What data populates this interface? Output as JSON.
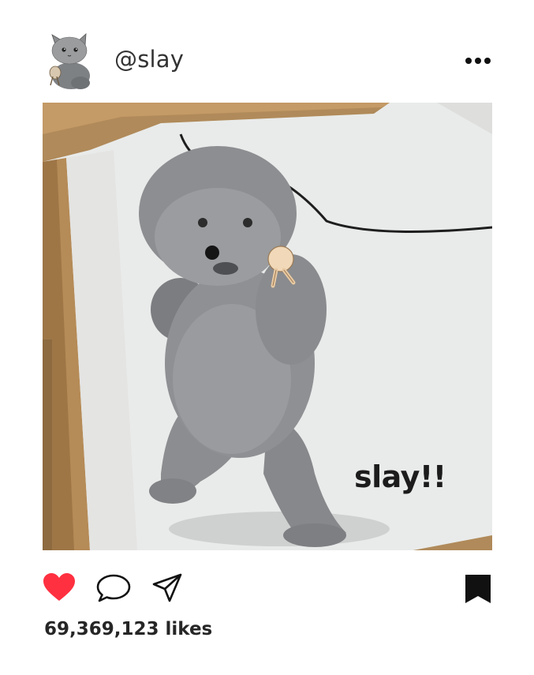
{
  "post": {
    "username": "@slay",
    "image_caption": "slay!!",
    "likes_text": "69,369,123 likes"
  },
  "icons": {
    "avatar": "cat-avatar-icon",
    "more": "more-dots-icon",
    "like": "heart-icon",
    "comment": "speech-bubble-icon",
    "share": "paper-plane-icon",
    "save": "bookmark-icon"
  },
  "colors": {
    "like_active": "#ff3040",
    "text": "#262626",
    "icon": "#111111"
  }
}
